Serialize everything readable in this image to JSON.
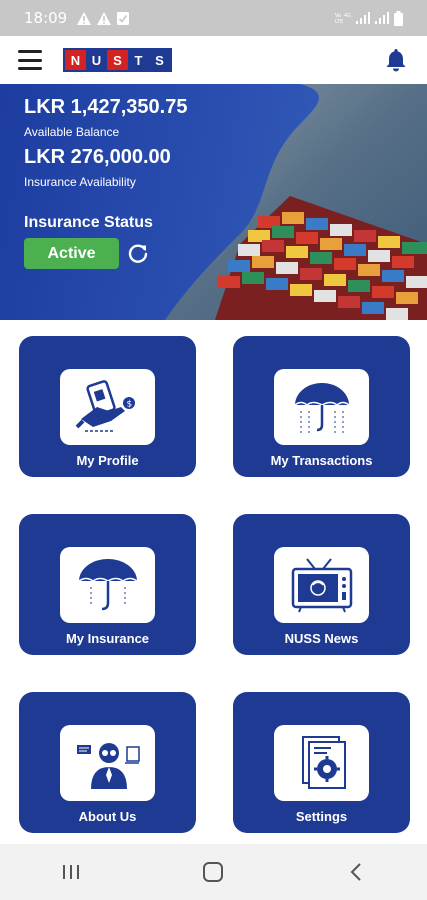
{
  "status_bar": {
    "time": "18:09",
    "icons_left": [
      "warning-icon",
      "warning-icon",
      "check-square-icon"
    ],
    "icons_right": [
      "volte-icon",
      "signal-icon",
      "signal-icon",
      "battery-icon"
    ]
  },
  "app_bar": {
    "logo_letters": [
      "N",
      "U",
      "S",
      "T",
      "S"
    ],
    "menu_icon": "hamburger-icon",
    "notification_icon": "bell-icon"
  },
  "banner": {
    "available_balance": "LKR 1,427,350.75",
    "available_balance_label": "Available Balance",
    "insurance_availability": "LKR 276,000.00",
    "insurance_availability_label": "Insurance Availability",
    "insurance_status_title": "Insurance Status",
    "insurance_status": "Active",
    "status_color": "#4caf50",
    "refresh_icon": "refresh-icon"
  },
  "tiles": [
    {
      "label": "My Profile",
      "icon": "id-card-hand-icon"
    },
    {
      "label": "My Transactions",
      "icon": "umbrella-rain-icon"
    },
    {
      "label": "My Insurance",
      "icon": "umbrella-icon"
    },
    {
      "label": "NUSS News",
      "icon": "tv-icon"
    },
    {
      "label": "About Us",
      "icon": "person-presenting-icon"
    },
    {
      "label": "Settings",
      "icon": "document-gear-icon"
    }
  ],
  "colors": {
    "brand_blue": "#1f3a93",
    "brand_red": "#d32222",
    "active_green": "#4caf50"
  },
  "nav_bar": {
    "recents_icon": "recents-icon",
    "home_icon": "home-icon",
    "back_icon": "back-icon"
  }
}
